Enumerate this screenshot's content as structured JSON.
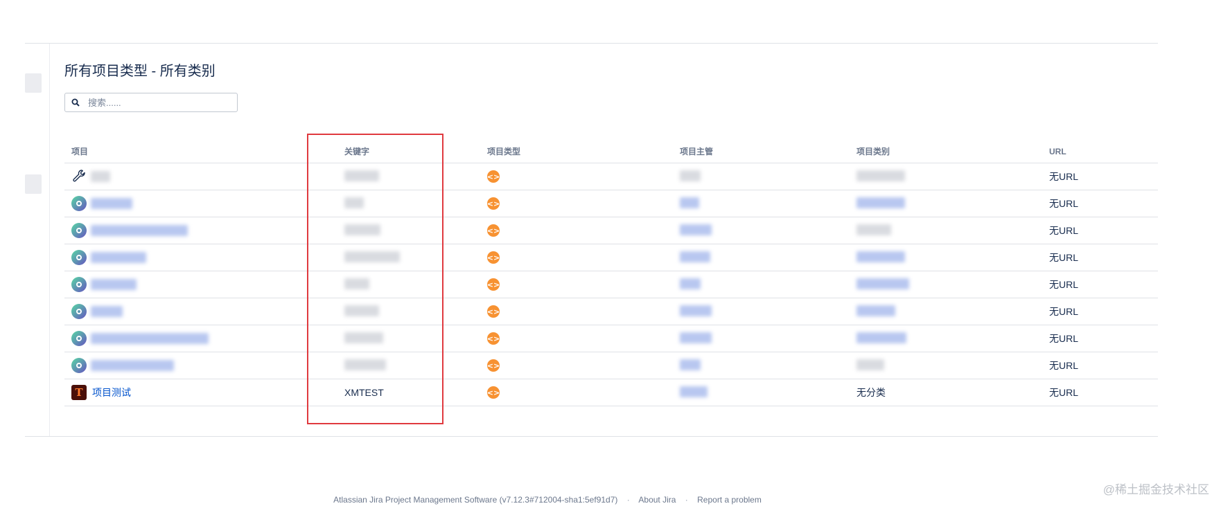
{
  "page": {
    "title": "所有项目类型 - 所有类别"
  },
  "search": {
    "placeholder": "搜索......"
  },
  "table": {
    "columns": [
      "项目",
      "关键字",
      "项目类型",
      "项目主管",
      "项目类别",
      "URL"
    ],
    "rows": [
      {
        "name": "",
        "key": "",
        "lead": "",
        "category": "",
        "url": "无URL",
        "avatar": "wrench-icon"
      },
      {
        "name": "",
        "key": "",
        "lead": "",
        "category": "",
        "url": "无URL",
        "avatar": "project-avatar-icon"
      },
      {
        "name": "",
        "key": "",
        "lead": "",
        "category": "",
        "url": "无URL",
        "avatar": "project-avatar-icon"
      },
      {
        "name": "",
        "key": "",
        "lead": "",
        "category": "",
        "url": "无URL",
        "avatar": "project-avatar-icon"
      },
      {
        "name": "",
        "key": "",
        "lead": "",
        "category": "",
        "url": "无URL",
        "avatar": "project-avatar-icon"
      },
      {
        "name": "",
        "key": "",
        "lead": "",
        "category": "",
        "url": "无URL",
        "avatar": "project-avatar-icon"
      },
      {
        "name": "",
        "key": "",
        "lead": "",
        "category": "",
        "url": "无URL",
        "avatar": "project-avatar-icon"
      },
      {
        "name": "",
        "key": "",
        "lead": "",
        "category": "",
        "url": "无URL",
        "avatar": "project-avatar-icon"
      },
      {
        "name": "项目测试",
        "key": "XMTEST",
        "lead": "",
        "category": "无分类",
        "url": "无URL",
        "avatar": "project-t-avatar-icon"
      }
    ]
  },
  "footer": {
    "software": "Atlassian Jira Project Management Software (v7.12.3#712004-sha1:5ef91d7)",
    "separator": "·",
    "about": "About Jira",
    "report": "Report a problem"
  },
  "watermark": "@稀土掘金技术社区",
  "colors": {
    "link": "#0052cc",
    "type_badge": "#f79232",
    "highlight": "#e0393e"
  }
}
